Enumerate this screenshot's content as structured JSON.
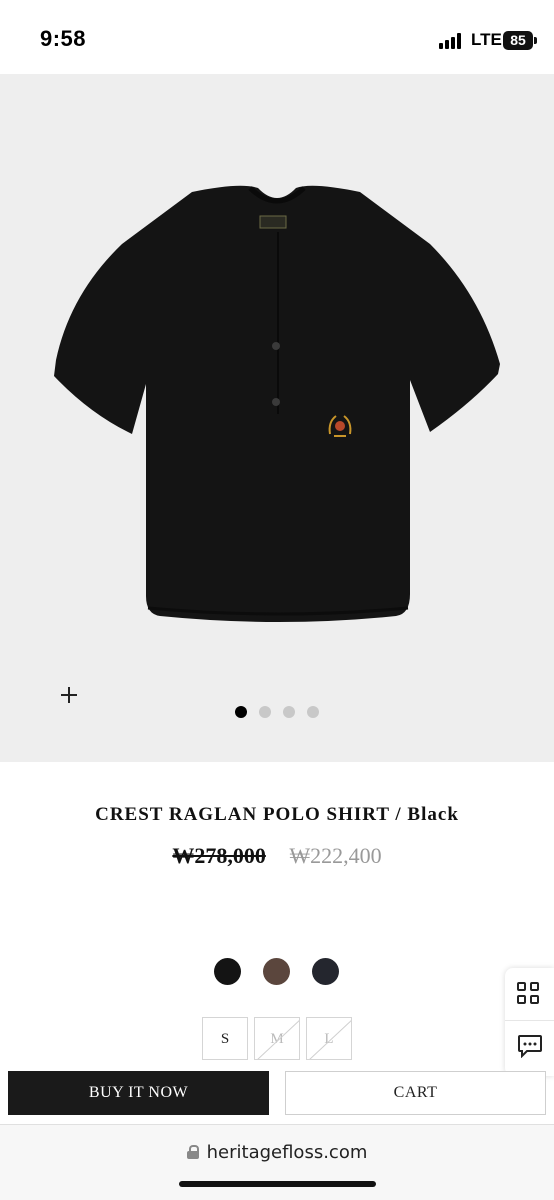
{
  "status_bar": {
    "time": "9:58",
    "network": "LTE",
    "battery": "85"
  },
  "product_gallery": {
    "image_alt": "Black knit polo shirt with crest emblem",
    "shirt_color": "#141414",
    "background_color": "#eeeeee",
    "zoom_icon": "plus-icon",
    "slide_count": 4,
    "active_slide": 1
  },
  "product": {
    "title": "CREST RAGLAN POLO SHIRT / Black",
    "original_price": "₩278,000",
    "sale_price": "₩222,400"
  },
  "color_options": [
    {
      "name": "Black",
      "hex": "#141414"
    },
    {
      "name": "Brown",
      "hex": "#5b463d"
    },
    {
      "name": "Navy",
      "hex": "#24262e"
    }
  ],
  "size_options": [
    {
      "label": "S",
      "sold_out": false
    },
    {
      "label": "M",
      "sold_out": true
    },
    {
      "label": "L",
      "sold_out": true
    }
  ],
  "floating_actions": {
    "grid_icon": "grid-icon",
    "chat_icon": "chat-icon"
  },
  "actions": {
    "buy_now_label": "BUY IT NOW",
    "cart_label": "CART"
  },
  "browser": {
    "url": "heritagefloss.com",
    "lock_icon": "lock-icon"
  }
}
